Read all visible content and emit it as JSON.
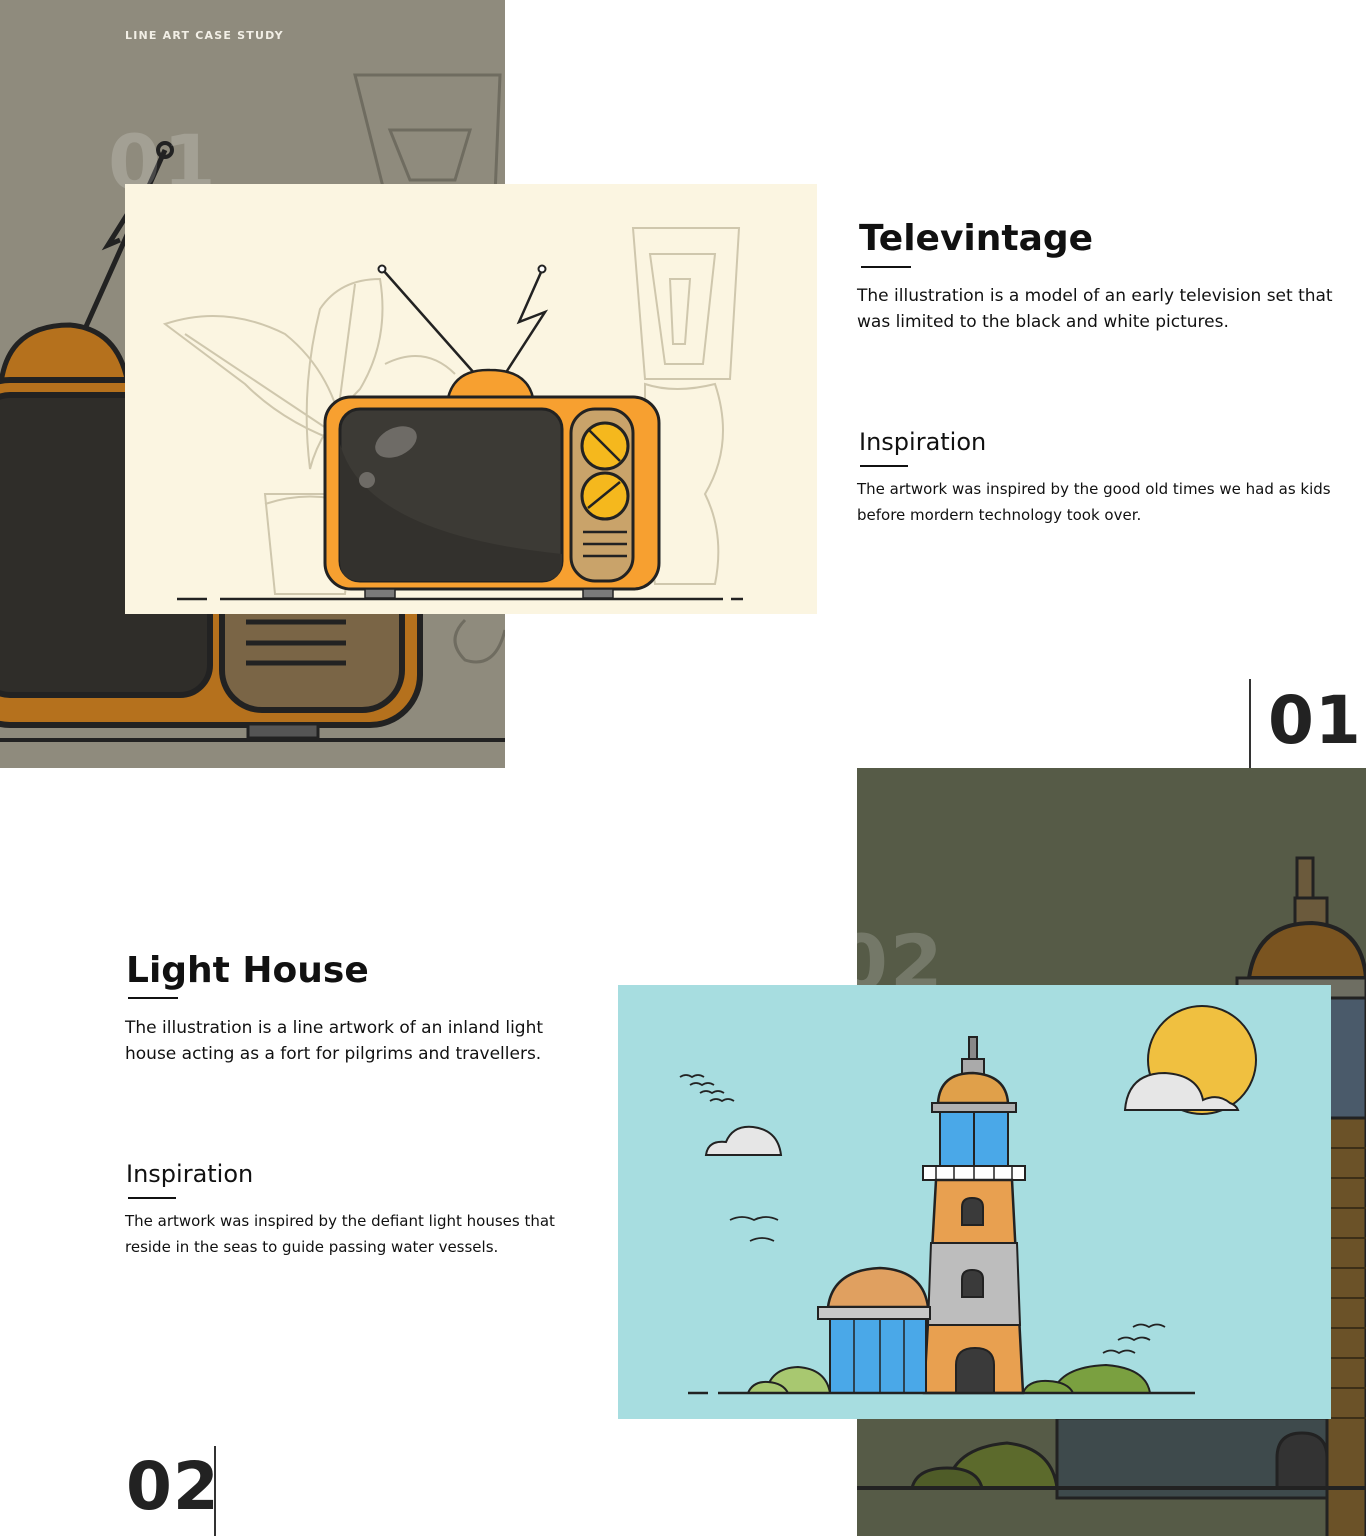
{
  "header": {
    "eyebrow": "LINE ART CASE STUDY"
  },
  "projects": [
    {
      "number": "01",
      "ghost_number": "01",
      "title": "Televintage",
      "description": "The illustration is a model of an early television set that was limited to the black and white pictures.",
      "inspiration_heading": "Inspiration",
      "inspiration_text": "The artwork was inspired by the good old times we had as kids before mordern technology took over."
    },
    {
      "number": "02",
      "ghost_number": "02",
      "title": "Light House",
      "description": "The illustration is a line artwork of an inland light house acting as a fort for pilgrims and travellers.",
      "inspiration_heading": "Inspiration",
      "inspiration_text": "The artwork was inspired by the defiant light houses that reside in the seas to guide passing water vessels."
    }
  ],
  "colors": {
    "tv_panel_bg": "#8f8b7d",
    "tv_card_bg": "#fbf5e1",
    "tv_orange": "#f7a030",
    "lh_panel_bg": "#565b47",
    "lh_card_bg": "#a7dde0",
    "sun": "#f0c040"
  }
}
